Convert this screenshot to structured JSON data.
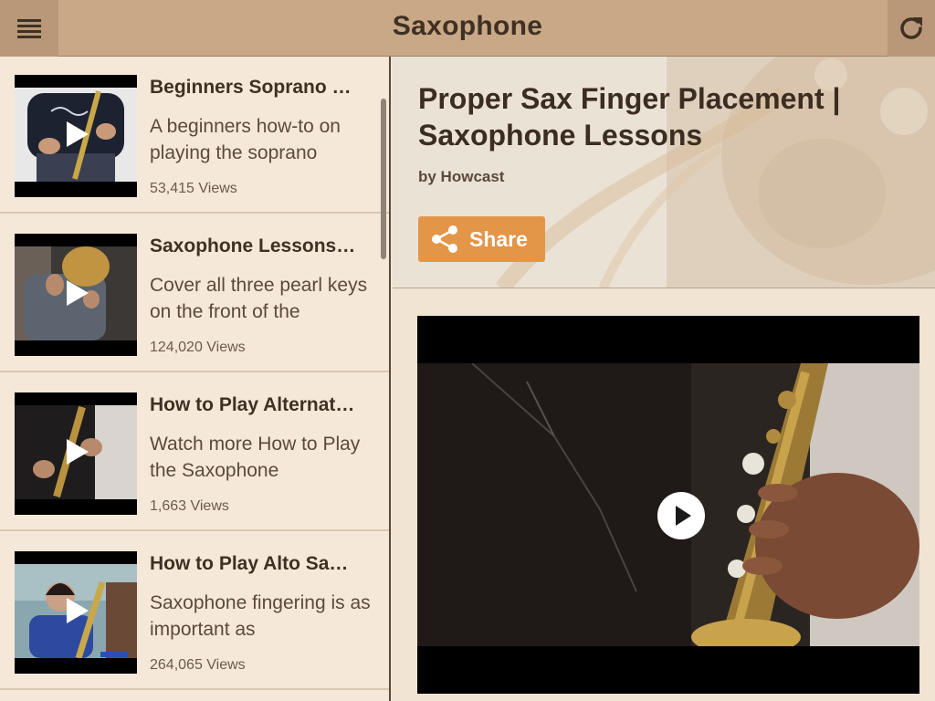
{
  "app": {
    "title": "Saxophone",
    "menu_icon": "hamburger-menu-icon",
    "refresh_icon": "refresh-icon"
  },
  "videos": [
    {
      "title": "Beginners Soprano …",
      "description": "A beginners how-to on playing the soprano",
      "views": "53,415 Views"
    },
    {
      "title": "Saxophone Lessons…",
      "description": "Cover all three pearl keys on the front of the",
      "views": "124,020 Views"
    },
    {
      "title": "How to Play Alternat…",
      "description": "Watch more How to Play the Saxophone",
      "views": "1,663 Views"
    },
    {
      "title": "How to Play Alto Sa…",
      "description": "Saxophone fingering is as important as",
      "views": "264,065 Views"
    }
  ],
  "detail": {
    "title": "Proper Sax Finger Placement | Saxophone Lessons",
    "author": "by Howcast",
    "share_label": "Share",
    "share_icon": "share-icon",
    "play_icon": "play-icon"
  },
  "colors": {
    "topbar": "#c8a886",
    "accent": "#e39548",
    "background": "#f2e4d2",
    "text_dark": "#3f3024"
  }
}
